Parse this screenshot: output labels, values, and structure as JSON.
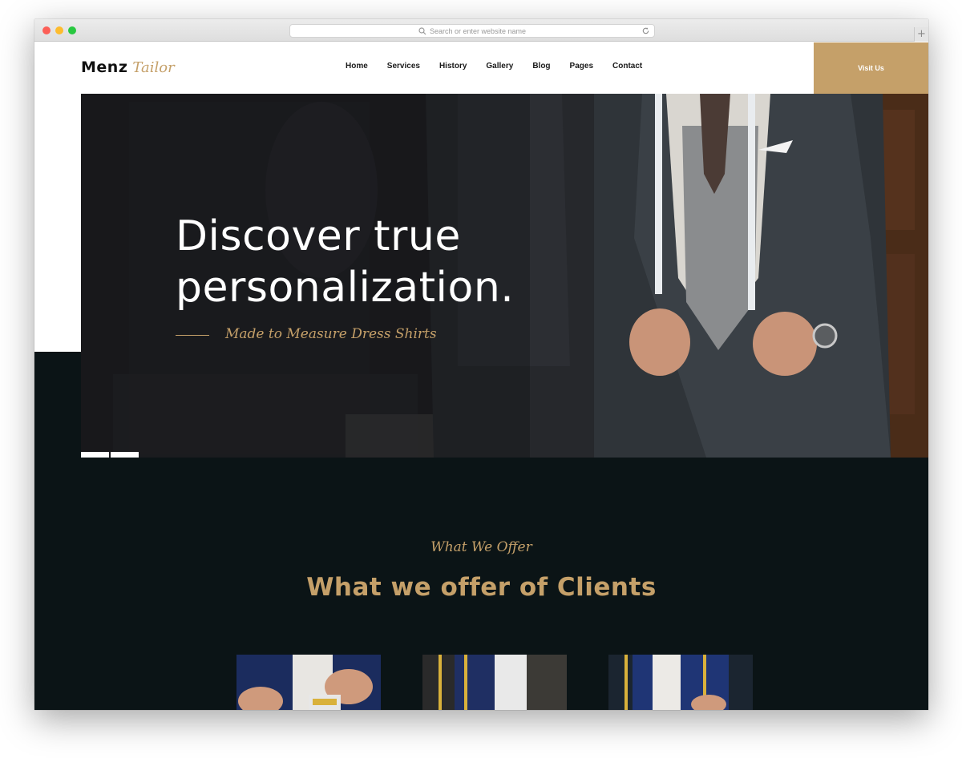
{
  "browser": {
    "url_placeholder": "Search or enter website name",
    "new_tab_label": "+"
  },
  "site": {
    "logo": {
      "primary": "Menz",
      "secondary": "Tailor"
    },
    "nav": [
      {
        "label": "Home"
      },
      {
        "label": "Services"
      },
      {
        "label": "History"
      },
      {
        "label": "Gallery"
      },
      {
        "label": "Blog"
      },
      {
        "label": "Pages"
      },
      {
        "label": "Contact"
      }
    ],
    "cta_label": "Visit Us",
    "hero": {
      "title_line1": "Discover true",
      "title_line2": "personalization.",
      "subtitle": "Made to Measure Dress Shirts",
      "slide_count": 2,
      "active_slide": 1
    },
    "offer": {
      "kicker": "What We Offer",
      "title": "What we offer of Clients"
    }
  },
  "colors": {
    "accent_gold": "#c5a069",
    "dark_background": "#0b1416",
    "hero_overlay": "#17191b"
  }
}
